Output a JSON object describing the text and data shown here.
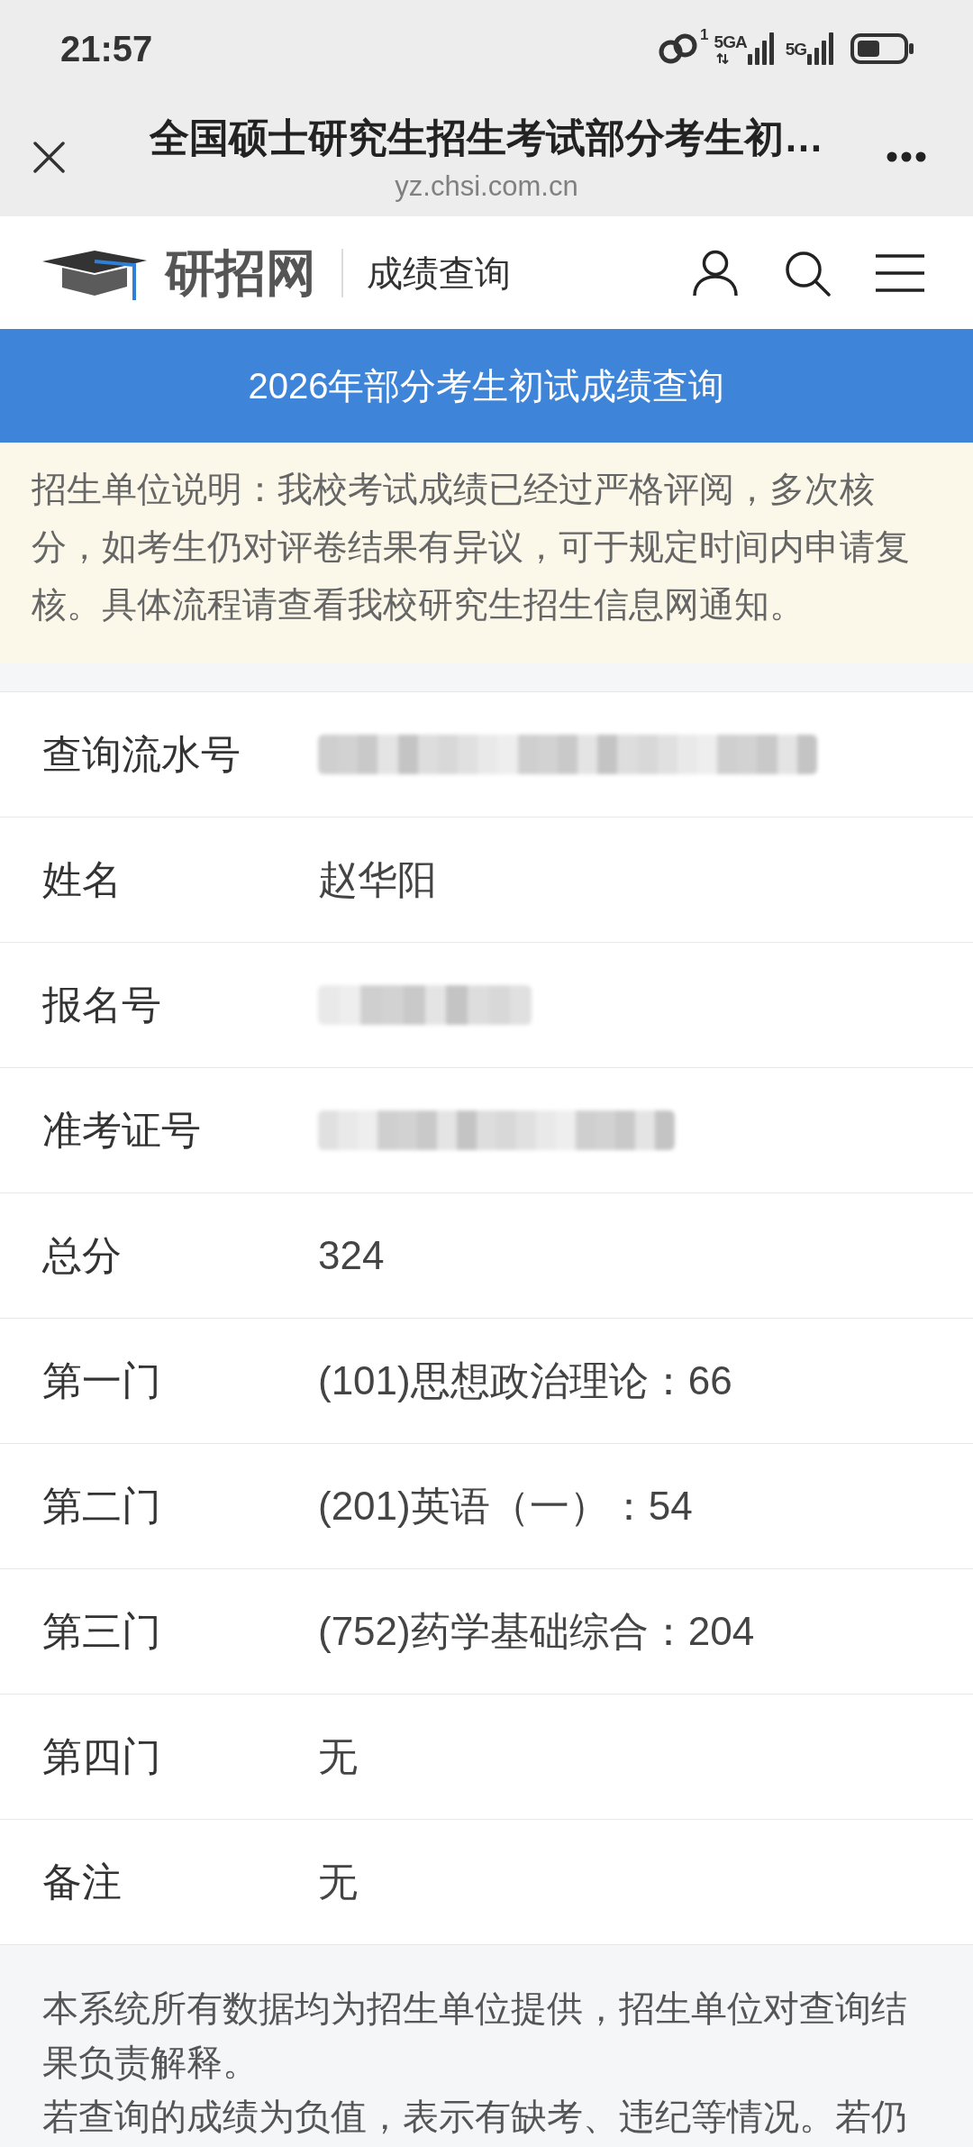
{
  "status_bar": {
    "time": "21:57",
    "signals": [
      {
        "sim": "1",
        "network": "5GA",
        "data_active": true
      },
      {
        "network": "5G",
        "data_active": false
      }
    ]
  },
  "browser_bar": {
    "title": "全国硕士研究生招生考试部分考生初…",
    "url": "yz.chsi.com.cn"
  },
  "site_header": {
    "logo_text": "研招网",
    "section": "成绩查询"
  },
  "banner": {
    "title": "2026年部分考生初试成绩查询"
  },
  "notice": {
    "text": "招生单位说明：我校考试成绩已经过严格评阅，多次核分，如考生仍对评卷结果有异议，可于规定时间内申请复核。具体流程请查看我校研究生招生信息网通知。"
  },
  "result_rows": [
    {
      "label": "查询流水号",
      "redacted": true
    },
    {
      "label": "姓名",
      "value": "赵华阳",
      "redacted": false
    },
    {
      "label": "报名号",
      "redacted": true
    },
    {
      "label": "准考证号",
      "redacted": true
    },
    {
      "label": "总分",
      "value": "324",
      "redacted": false
    },
    {
      "label": "第一门",
      "value": "(101)思想政治理论：66",
      "redacted": false
    },
    {
      "label": "第二门",
      "value": "(201)英语（一）：54",
      "redacted": false
    },
    {
      "label": "第三门",
      "value": "(752)药学基础综合：204",
      "redacted": false
    },
    {
      "label": "第四门",
      "value": "无",
      "redacted": false
    },
    {
      "label": "备注",
      "value": "无",
      "redacted": false
    }
  ],
  "footer": {
    "paragraphs": [
      "本系统所有数据均为招生单位提供，招生单位对查询结果负责解释。",
      "若查询的成绩为负值，表示有缺考、违纪等情况。若仍"
    ]
  }
}
